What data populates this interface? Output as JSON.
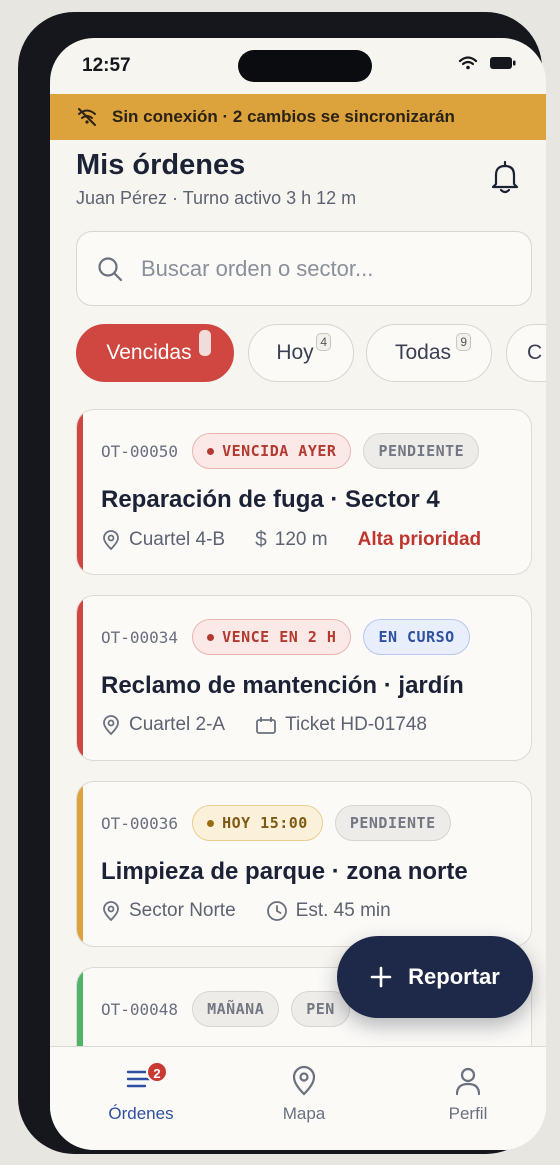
{
  "status": {
    "time": "12:57"
  },
  "banner": {
    "text": "Sin conexión · 2 cambios se sincronizarán",
    "color": "#dca23c"
  },
  "header": {
    "title": "Mis órdenes",
    "subtitle": "Juan Pérez · Turno activo 3 h 12 m"
  },
  "search": {
    "placeholder": "Buscar orden o sector..."
  },
  "filters": [
    {
      "label": "Vencidas",
      "count": "",
      "active": true
    },
    {
      "label": "Hoy",
      "count": "4",
      "active": false
    },
    {
      "label": "Todas",
      "count": "9",
      "active": false
    },
    {
      "label": "C",
      "count": "",
      "active": false
    }
  ],
  "orders": [
    {
      "id": "OT-00050",
      "status": "VENCIDA AYER",
      "state": "PENDIENTE",
      "title": "Reparación de fuga · Sector 4",
      "location": "Cuartel 4-B",
      "extra": "120 m",
      "priority": "Alta prioridad",
      "accent": "#cf4740"
    },
    {
      "id": "OT-00034",
      "status": "VENCE EN 2 H",
      "state": "EN CURSO",
      "title": "Reclamo de mantención · jardín",
      "location": "Cuartel 2-A",
      "extra": "Ticket HD-01748",
      "accent": "#cf4740"
    },
    {
      "id": "OT-00036",
      "status": "HOY 15:00",
      "state": "PENDIENTE",
      "title": "Limpieza de parque · zona norte",
      "location": "Sector Norte",
      "extra": "Est. 45 min",
      "accent": "#dca23c"
    },
    {
      "id": "OT-00048",
      "status": "MAÑANA",
      "state": "PEN",
      "accent": "#4fb36a"
    }
  ],
  "fab": {
    "label": "Reportar"
  },
  "tabs": [
    {
      "label": "Órdenes",
      "badge": "2",
      "icon": "list-icon",
      "active": true
    },
    {
      "label": "Mapa",
      "icon": "map-pin-icon",
      "active": false
    },
    {
      "label": "Perfil",
      "icon": "user-icon",
      "active": false
    }
  ]
}
